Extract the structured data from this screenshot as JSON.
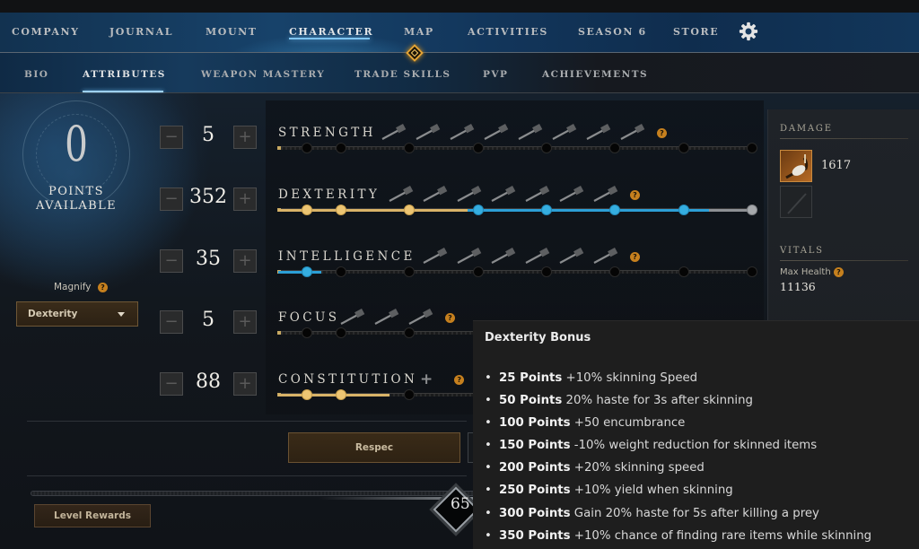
{
  "nav": {
    "items": [
      {
        "label": "COMPANY",
        "active": false
      },
      {
        "label": "JOURNAL",
        "active": false
      },
      {
        "label": "MOUNT",
        "active": false
      },
      {
        "label": "CHARACTER",
        "active": true
      },
      {
        "label": "MAP",
        "active": false
      },
      {
        "label": "ACTIVITIES",
        "active": false
      },
      {
        "label": "SEASON 6",
        "active": false
      },
      {
        "label": "STORE",
        "active": false
      }
    ],
    "settings_icon": "gear-icon",
    "map_indicator_icon": "diamond-marker-icon"
  },
  "subnav": {
    "items": [
      {
        "label": "BIO",
        "active": false
      },
      {
        "label": "ATTRIBUTES",
        "active": true
      },
      {
        "label": "WEAPON MASTERY",
        "active": false
      },
      {
        "label": "TRADE SKILLS",
        "active": false
      },
      {
        "label": "PVP",
        "active": false
      },
      {
        "label": "ACHIEVEMENTS",
        "active": false
      }
    ]
  },
  "points": {
    "value": "0",
    "label_line1": "POINTS",
    "label_line2": "AVAILABLE"
  },
  "magnify": {
    "label": "Magnify",
    "help": "?",
    "selected": "Dexterity"
  },
  "attributes": [
    {
      "name": "STRENGTH",
      "value": "5",
      "fill_fraction": 0.0,
      "fill_color": "gold",
      "weapons": [
        "hatchet-icon",
        "war-hammer-icon",
        "sledge-icon",
        "blunderbuss-icon",
        "spear-icon",
        "great-axe-icon",
        "axe-icon",
        "rapier-icon"
      ],
      "nodes": [
        "empty",
        "empty",
        "empty",
        "empty",
        "empty",
        "empty",
        "empty",
        "empty"
      ]
    },
    {
      "name": "DEXTERITY",
      "value": "352",
      "fill_fraction": 0.91,
      "fill_color": "mixed",
      "weapons": [
        "bow-icon",
        "musket-icon",
        "rapier-icon",
        "spear-icon",
        "hatchet-icon",
        "axe-icon",
        "sword-icon"
      ],
      "nodes": [
        "gold",
        "gold",
        "gold",
        "blue",
        "blue",
        "blue",
        "blue",
        "grey"
      ]
    },
    {
      "name": "INTELLIGENCE",
      "value": "35",
      "fill_fraction": 0.09,
      "fill_color": "blue",
      "weapons": [
        "fire-staff-icon",
        "ice-staff-icon",
        "gauntlet-icon",
        "rapier-icon",
        "musket-icon",
        "blunderbuss-icon"
      ],
      "nodes": [
        "blue",
        "empty",
        "empty",
        "empty",
        "empty",
        "empty",
        "empty",
        "empty"
      ]
    },
    {
      "name": "FOCUS",
      "value": "5",
      "fill_fraction": 0.0,
      "fill_color": "gold",
      "weapons": [
        "life-staff-icon",
        "void-gauntlet-icon",
        "ice-gauntlet-icon"
      ],
      "nodes": [
        "empty",
        "empty",
        "empty",
        "empty",
        "empty",
        "empty",
        "empty",
        "empty"
      ]
    },
    {
      "name": "CONSTITUTION",
      "value": "88",
      "fill_fraction": 0.235,
      "fill_color": "gold",
      "weapons": [],
      "nodes": [
        "gold",
        "gold",
        "empty",
        "empty",
        "empty",
        "empty",
        "empty",
        "empty"
      ]
    }
  ],
  "attribute_help": "?",
  "buttons": {
    "respec": "Respec",
    "level_rewards": "Level Rewards"
  },
  "level": "65",
  "right_panel": {
    "damage_header": "DAMAGE",
    "damage_value": "1617",
    "vitals_header": "VITALS",
    "max_health_label": "Max Health",
    "max_health_help": "?",
    "max_health_value": "11136"
  },
  "tooltip": {
    "title": "Dexterity Bonus",
    "items": [
      {
        "points": "25 Points",
        "text": "+10% skinning Speed"
      },
      {
        "points": "50 Points",
        "text": "20% haste for 3s after skinning"
      },
      {
        "points": "100 Points",
        "text": "+50 encumbrance"
      },
      {
        "points": "150 Points",
        "text": "-10% weight reduction for skinned items"
      },
      {
        "points": "200 Points",
        "text": "+20% skinning speed"
      },
      {
        "points": "250 Points",
        "text": "+10% yield when skinning"
      },
      {
        "points": "300 Points",
        "text": "Gain 20% haste for 5s after killing a prey"
      },
      {
        "points": "350 Points",
        "text": "+10% chance of finding rare items while skinning"
      }
    ]
  },
  "colors": {
    "gold_node": "#ecc573",
    "blue_node": "#35aee0",
    "help_badge": "#c6801e",
    "nav_active_glow": "#7fc4f0"
  }
}
